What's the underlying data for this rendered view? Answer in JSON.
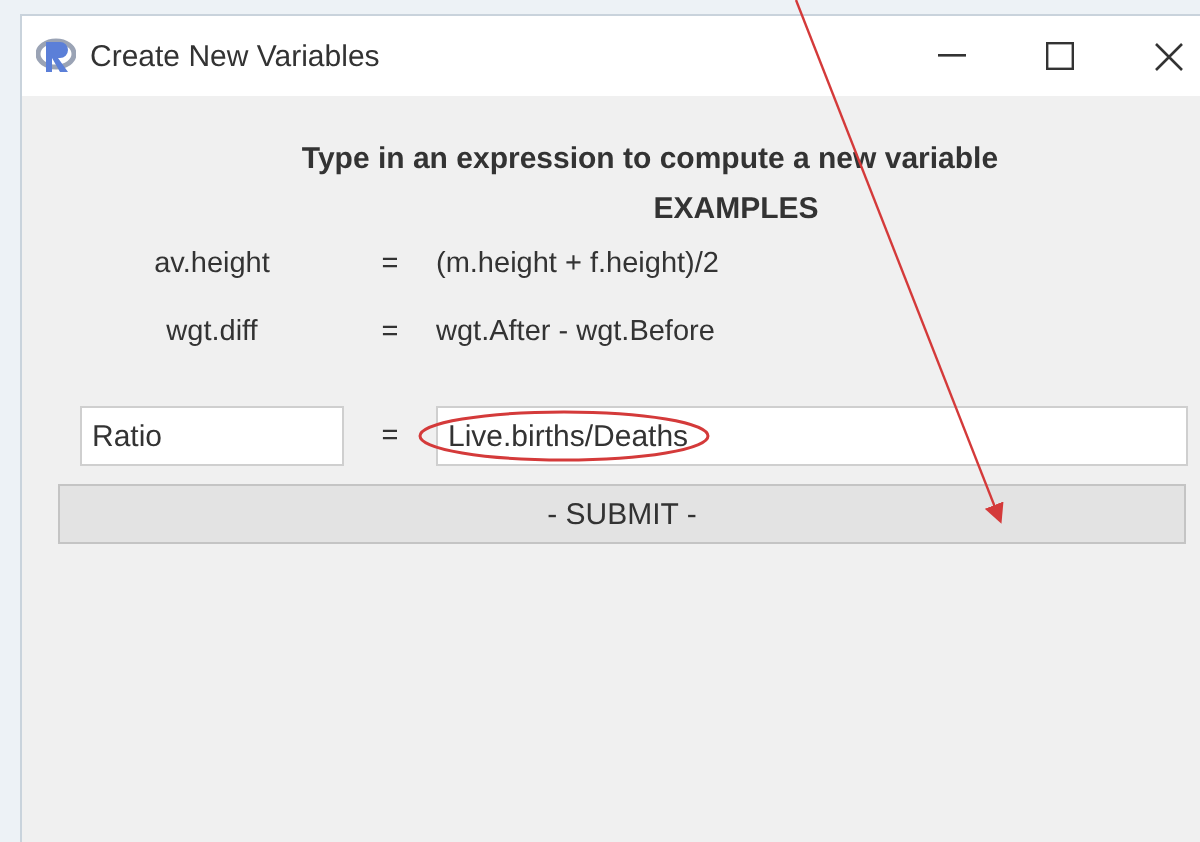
{
  "window": {
    "title": "Create New Variables"
  },
  "heading": "Type in an expression to compute a new variable",
  "subheading": "EXAMPLES",
  "examples": [
    {
      "name": "av.height",
      "equals": "=",
      "expression": "(m.height + f.height)/2"
    },
    {
      "name": "wgt.diff",
      "equals": "=",
      "expression": "wgt.After - wgt.Before"
    }
  ],
  "form": {
    "name_value": "Ratio",
    "equals": "=",
    "expression_value": "Live.births/Deaths"
  },
  "submit": {
    "label": "- SUBMIT -"
  }
}
